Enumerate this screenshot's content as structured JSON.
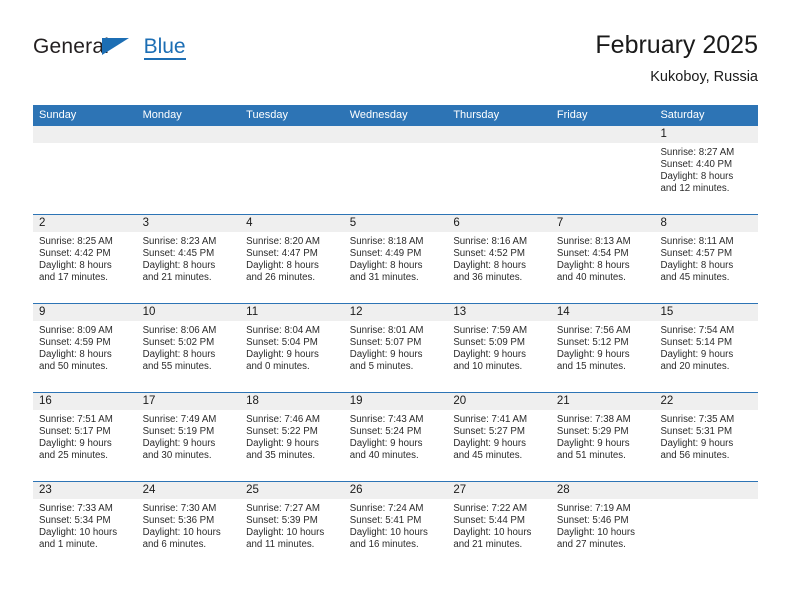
{
  "brand": {
    "name_part1": "General",
    "name_part2": "Blue"
  },
  "header": {
    "title": "February 2025",
    "location": "Kukoboy, Russia"
  },
  "colors": {
    "header_blue": "#2d74b5",
    "brand_blue": "#1c6eb4",
    "date_band": "#efefef",
    "text": "#2b2b2b"
  },
  "weekday_headers": [
    "Sunday",
    "Monday",
    "Tuesday",
    "Wednesday",
    "Thursday",
    "Friday",
    "Saturday"
  ],
  "weeks": [
    [
      {
        "empty": true
      },
      {
        "empty": true
      },
      {
        "empty": true
      },
      {
        "empty": true
      },
      {
        "empty": true
      },
      {
        "empty": true
      },
      {
        "day": "1",
        "sunrise": "Sunrise: 8:27 AM",
        "sunset": "Sunset: 4:40 PM",
        "daylight_1": "Daylight: 8 hours",
        "daylight_2": "and 12 minutes."
      }
    ],
    [
      {
        "day": "2",
        "sunrise": "Sunrise: 8:25 AM",
        "sunset": "Sunset: 4:42 PM",
        "daylight_1": "Daylight: 8 hours",
        "daylight_2": "and 17 minutes."
      },
      {
        "day": "3",
        "sunrise": "Sunrise: 8:23 AM",
        "sunset": "Sunset: 4:45 PM",
        "daylight_1": "Daylight: 8 hours",
        "daylight_2": "and 21 minutes."
      },
      {
        "day": "4",
        "sunrise": "Sunrise: 8:20 AM",
        "sunset": "Sunset: 4:47 PM",
        "daylight_1": "Daylight: 8 hours",
        "daylight_2": "and 26 minutes."
      },
      {
        "day": "5",
        "sunrise": "Sunrise: 8:18 AM",
        "sunset": "Sunset: 4:49 PM",
        "daylight_1": "Daylight: 8 hours",
        "daylight_2": "and 31 minutes."
      },
      {
        "day": "6",
        "sunrise": "Sunrise: 8:16 AM",
        "sunset": "Sunset: 4:52 PM",
        "daylight_1": "Daylight: 8 hours",
        "daylight_2": "and 36 minutes."
      },
      {
        "day": "7",
        "sunrise": "Sunrise: 8:13 AM",
        "sunset": "Sunset: 4:54 PM",
        "daylight_1": "Daylight: 8 hours",
        "daylight_2": "and 40 minutes."
      },
      {
        "day": "8",
        "sunrise": "Sunrise: 8:11 AM",
        "sunset": "Sunset: 4:57 PM",
        "daylight_1": "Daylight: 8 hours",
        "daylight_2": "and 45 minutes."
      }
    ],
    [
      {
        "day": "9",
        "sunrise": "Sunrise: 8:09 AM",
        "sunset": "Sunset: 4:59 PM",
        "daylight_1": "Daylight: 8 hours",
        "daylight_2": "and 50 minutes."
      },
      {
        "day": "10",
        "sunrise": "Sunrise: 8:06 AM",
        "sunset": "Sunset: 5:02 PM",
        "daylight_1": "Daylight: 8 hours",
        "daylight_2": "and 55 minutes."
      },
      {
        "day": "11",
        "sunrise": "Sunrise: 8:04 AM",
        "sunset": "Sunset: 5:04 PM",
        "daylight_1": "Daylight: 9 hours",
        "daylight_2": "and 0 minutes."
      },
      {
        "day": "12",
        "sunrise": "Sunrise: 8:01 AM",
        "sunset": "Sunset: 5:07 PM",
        "daylight_1": "Daylight: 9 hours",
        "daylight_2": "and 5 minutes."
      },
      {
        "day": "13",
        "sunrise": "Sunrise: 7:59 AM",
        "sunset": "Sunset: 5:09 PM",
        "daylight_1": "Daylight: 9 hours",
        "daylight_2": "and 10 minutes."
      },
      {
        "day": "14",
        "sunrise": "Sunrise: 7:56 AM",
        "sunset": "Sunset: 5:12 PM",
        "daylight_1": "Daylight: 9 hours",
        "daylight_2": "and 15 minutes."
      },
      {
        "day": "15",
        "sunrise": "Sunrise: 7:54 AM",
        "sunset": "Sunset: 5:14 PM",
        "daylight_1": "Daylight: 9 hours",
        "daylight_2": "and 20 minutes."
      }
    ],
    [
      {
        "day": "16",
        "sunrise": "Sunrise: 7:51 AM",
        "sunset": "Sunset: 5:17 PM",
        "daylight_1": "Daylight: 9 hours",
        "daylight_2": "and 25 minutes."
      },
      {
        "day": "17",
        "sunrise": "Sunrise: 7:49 AM",
        "sunset": "Sunset: 5:19 PM",
        "daylight_1": "Daylight: 9 hours",
        "daylight_2": "and 30 minutes."
      },
      {
        "day": "18",
        "sunrise": "Sunrise: 7:46 AM",
        "sunset": "Sunset: 5:22 PM",
        "daylight_1": "Daylight: 9 hours",
        "daylight_2": "and 35 minutes."
      },
      {
        "day": "19",
        "sunrise": "Sunrise: 7:43 AM",
        "sunset": "Sunset: 5:24 PM",
        "daylight_1": "Daylight: 9 hours",
        "daylight_2": "and 40 minutes."
      },
      {
        "day": "20",
        "sunrise": "Sunrise: 7:41 AM",
        "sunset": "Sunset: 5:27 PM",
        "daylight_1": "Daylight: 9 hours",
        "daylight_2": "and 45 minutes."
      },
      {
        "day": "21",
        "sunrise": "Sunrise: 7:38 AM",
        "sunset": "Sunset: 5:29 PM",
        "daylight_1": "Daylight: 9 hours",
        "daylight_2": "and 51 minutes."
      },
      {
        "day": "22",
        "sunrise": "Sunrise: 7:35 AM",
        "sunset": "Sunset: 5:31 PM",
        "daylight_1": "Daylight: 9 hours",
        "daylight_2": "and 56 minutes."
      }
    ],
    [
      {
        "day": "23",
        "sunrise": "Sunrise: 7:33 AM",
        "sunset": "Sunset: 5:34 PM",
        "daylight_1": "Daylight: 10 hours",
        "daylight_2": "and 1 minute."
      },
      {
        "day": "24",
        "sunrise": "Sunrise: 7:30 AM",
        "sunset": "Sunset: 5:36 PM",
        "daylight_1": "Daylight: 10 hours",
        "daylight_2": "and 6 minutes."
      },
      {
        "day": "25",
        "sunrise": "Sunrise: 7:27 AM",
        "sunset": "Sunset: 5:39 PM",
        "daylight_1": "Daylight: 10 hours",
        "daylight_2": "and 11 minutes."
      },
      {
        "day": "26",
        "sunrise": "Sunrise: 7:24 AM",
        "sunset": "Sunset: 5:41 PM",
        "daylight_1": "Daylight: 10 hours",
        "daylight_2": "and 16 minutes."
      },
      {
        "day": "27",
        "sunrise": "Sunrise: 7:22 AM",
        "sunset": "Sunset: 5:44 PM",
        "daylight_1": "Daylight: 10 hours",
        "daylight_2": "and 21 minutes."
      },
      {
        "day": "28",
        "sunrise": "Sunrise: 7:19 AM",
        "sunset": "Sunset: 5:46 PM",
        "daylight_1": "Daylight: 10 hours",
        "daylight_2": "and 27 minutes."
      },
      {
        "empty": true
      }
    ]
  ]
}
